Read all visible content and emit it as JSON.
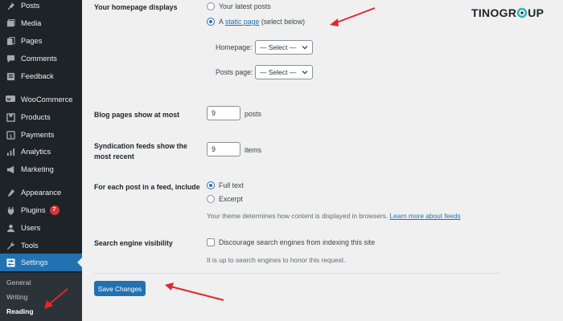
{
  "sidebar": {
    "items": [
      {
        "label": "Posts",
        "icon": "pin-icon"
      },
      {
        "label": "Media",
        "icon": "media-icon"
      },
      {
        "label": "Pages",
        "icon": "pages-icon"
      },
      {
        "label": "Comments",
        "icon": "comments-icon"
      },
      {
        "label": "Feedback",
        "icon": "feedback-icon"
      },
      {
        "label": "WooCommerce",
        "icon": "woocommerce-icon"
      },
      {
        "label": "Products",
        "icon": "products-icon"
      },
      {
        "label": "Payments",
        "icon": "payments-icon"
      },
      {
        "label": "Analytics",
        "icon": "analytics-icon"
      },
      {
        "label": "Marketing",
        "icon": "marketing-icon"
      },
      {
        "label": "Appearance",
        "icon": "appearance-icon"
      },
      {
        "label": "Plugins",
        "icon": "plugins-icon",
        "badge": "7"
      },
      {
        "label": "Users",
        "icon": "users-icon"
      },
      {
        "label": "Tools",
        "icon": "tools-icon"
      },
      {
        "label": "Settings",
        "icon": "settings-icon"
      }
    ],
    "submenu": [
      "General",
      "Writing",
      "Reading"
    ]
  },
  "homepage": {
    "label": "Your homepage displays",
    "option_latest": "Your latest posts",
    "option_static_prefix": "A",
    "option_static_link": "static page",
    "option_static_suffix": "(select below)",
    "homepage_label": "Homepage:",
    "homepage_value": "— Select —",
    "posts_page_label": "Posts page:",
    "posts_page_value": "— Select —"
  },
  "blog_pages": {
    "label": "Blog pages show at most",
    "value": "9",
    "unit": "posts"
  },
  "syndication": {
    "label_line1": "Syndication feeds show the",
    "label_line2": "most recent",
    "value": "9",
    "unit": "items"
  },
  "feed_include": {
    "label": "For each post in a feed, include",
    "option_full": "Full text",
    "option_excerpt": "Excerpt",
    "desc_prefix": "Your theme determines how content is displayed in browsers.",
    "desc_link": "Learn more about feeds"
  },
  "search_visibility": {
    "label": "Search engine visibility",
    "checkbox_label": "Discourage search engines from indexing this site",
    "desc": "It is up to search engines to honor this request."
  },
  "save_label": "Save Changes",
  "logo": {
    "part1": "TINO",
    "part2": "GR",
    "part3": "UP"
  },
  "colors": {
    "accent": "#2271b1",
    "sidebar": "#1d2327",
    "arrow": "#e3262c",
    "logo_accent": "#2fb3c0"
  }
}
